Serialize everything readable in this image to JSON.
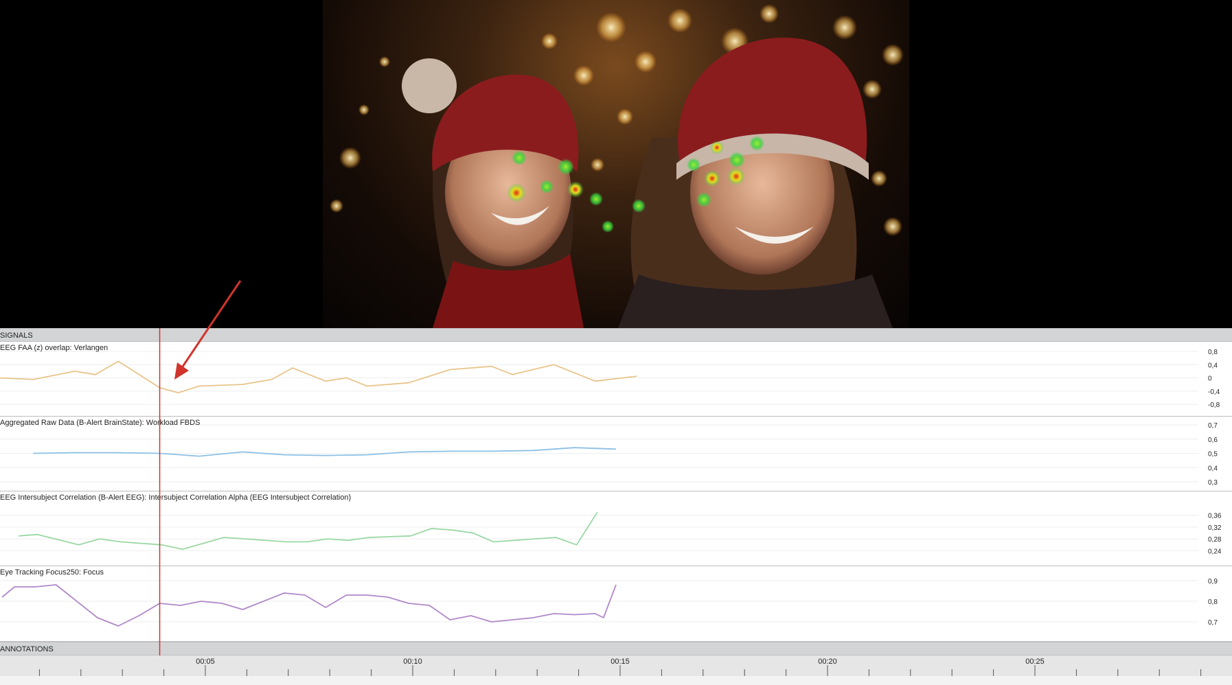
{
  "sections": {
    "signals_label": "SIGNALS",
    "annotations_label": "ANNOTATIONS"
  },
  "colors": {
    "playhead": "#d0342c",
    "annotation_arrow": "#d0342c",
    "heatmap_hot": "#e02a18",
    "heatmap_mid": "#e6e020",
    "heatmap_cool": "#38d640"
  },
  "signals": [
    {
      "label": "EEG FAA (z) overlap: Verlangen",
      "color": "#e8c48a",
      "y_ticks": [
        "0,8",
        "0,4",
        "0",
        "-0,4",
        "-0,8"
      ],
      "y_range": [
        -0.8,
        0.8
      ],
      "t": [
        0,
        0.85,
        1.85,
        2.35,
        2.9,
        3.9,
        4.35,
        4.85,
        5.9,
        6.6,
        7.1,
        7.9,
        8.4,
        8.9,
        9.9,
        10.9,
        11.9,
        12.4,
        13.4,
        14.4,
        15.4
      ],
      "values": [
        0.0,
        -0.05,
        0.2,
        0.1,
        0.5,
        -0.3,
        -0.45,
        -0.25,
        -0.2,
        -0.05,
        0.3,
        -0.1,
        0.0,
        -0.25,
        -0.15,
        0.25,
        0.35,
        0.1,
        0.4,
        -0.1,
        0.05
      ]
    },
    {
      "label": "Aggregated Raw Data (B-Alert BrainState): Workload FBDS",
      "color": "#8cc0e6",
      "y_ticks": [
        "0,7",
        "0,6",
        "0,5",
        "0,4",
        "0,3"
      ],
      "y_range": [
        0.3,
        0.7
      ],
      "t": [
        0.85,
        1.85,
        2.85,
        3.9,
        4.85,
        5.9,
        6.9,
        7.9,
        8.9,
        9.9,
        10.9,
        11.9,
        12.9,
        13.9,
        14.9
      ],
      "values": [
        0.5,
        0.505,
        0.505,
        0.5,
        0.48,
        0.51,
        0.49,
        0.485,
        0.49,
        0.51,
        0.515,
        0.515,
        0.52,
        0.54,
        0.53
      ]
    },
    {
      "label": "EEG Intersubject Correlation (B-Alert EEG): Intersubject Correlation Alpha (EEG Intersubject Correlation)",
      "color": "#9ad8a4",
      "y_ticks": [
        "0,36",
        "0,32",
        "0,28",
        "0,24"
      ],
      "y_range": [
        0.22,
        0.38
      ],
      "t": [
        0.5,
        0.95,
        1.95,
        2.45,
        2.95,
        3.95,
        4.45,
        5.45,
        6.95,
        7.45,
        7.95,
        8.45,
        8.95,
        9.95,
        10.45,
        10.95,
        11.45,
        11.95,
        12.45,
        12.95,
        13.45,
        13.95,
        14.45
      ],
      "values": [
        0.29,
        0.295,
        0.26,
        0.28,
        0.27,
        0.26,
        0.245,
        0.285,
        0.27,
        0.27,
        0.28,
        0.275,
        0.285,
        0.29,
        0.315,
        0.31,
        0.3,
        0.27,
        0.275,
        0.28,
        0.285,
        0.26,
        0.37
      ]
    },
    {
      "label": "Eye Tracking Focus250: Focus",
      "color": "#b088c8",
      "y_ticks": [
        "0,9",
        "0,8",
        "0,7"
      ],
      "y_range": [
        0.65,
        0.93
      ],
      "t": [
        0.1,
        0.4,
        0.9,
        1.4,
        2.4,
        2.9,
        3.4,
        3.9,
        4.4,
        4.9,
        5.4,
        5.9,
        6.9,
        7.4,
        7.9,
        8.4,
        8.9,
        9.4,
        9.9,
        10.4,
        10.9,
        11.4,
        11.9,
        12.4,
        12.9,
        13.4,
        13.9,
        14.4,
        14.6,
        14.9
      ],
      "values": [
        0.82,
        0.87,
        0.87,
        0.88,
        0.72,
        0.68,
        0.73,
        0.79,
        0.78,
        0.8,
        0.79,
        0.76,
        0.84,
        0.83,
        0.77,
        0.83,
        0.83,
        0.82,
        0.79,
        0.78,
        0.71,
        0.73,
        0.7,
        0.71,
        0.72,
        0.74,
        0.735,
        0.74,
        0.72,
        0.88
      ]
    }
  ],
  "timeline": {
    "ticks": [
      "00:05",
      "00:10",
      "00:15",
      "00:20",
      "00:25"
    ],
    "tick_seconds": [
      5,
      10,
      15,
      20,
      25
    ],
    "start_seconds": 0,
    "seconds_per_minor": 1,
    "playhead_seconds": 3.9
  }
}
